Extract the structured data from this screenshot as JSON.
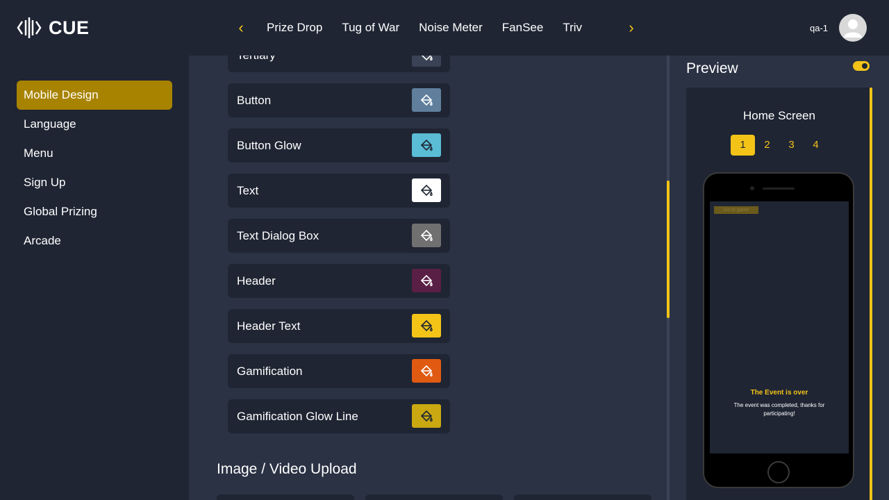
{
  "brand": {
    "logo_text": "CUE"
  },
  "header": {
    "tabs": [
      "Prize Drop",
      "Tug of War",
      "Noise Meter",
      "FanSee",
      "Triv"
    ],
    "user_name": "qa-1"
  },
  "sidebar": {
    "items": [
      {
        "label": "Mobile Design",
        "active": true
      },
      {
        "label": "Language"
      },
      {
        "label": "Menu"
      },
      {
        "label": "Sign Up"
      },
      {
        "label": "Global Prizing"
      },
      {
        "label": "Arcade"
      }
    ]
  },
  "colors": {
    "accent": "#f3c318",
    "rows": [
      {
        "label": "Tertiary",
        "color": "#3a4356"
      },
      {
        "label": "Button",
        "color": "#5f7f9c"
      },
      {
        "label": "Button Glow",
        "color": "#5bbcd6"
      },
      {
        "label": "Text",
        "color": "#ffffff"
      },
      {
        "label": "Text Dialog Box",
        "color": "#707070"
      },
      {
        "label": "Header",
        "color": "#5a1f45"
      },
      {
        "label": "Header Text",
        "color": "#f3c318"
      },
      {
        "label": "Gamification",
        "color": "#e05a12"
      },
      {
        "label": "Gamification Glow Line",
        "color": "#c9a812"
      }
    ]
  },
  "upload": {
    "title": "Image / Video Upload"
  },
  "preview": {
    "title": "Preview",
    "screen_title": "Home Screen",
    "pages": [
      "1",
      "2",
      "3",
      "4"
    ],
    "active_page": "1",
    "phone": {
      "go_button": "Go to game",
      "event_title": "The Event is over",
      "event_message": "The event was completed, thanks for participating!"
    }
  }
}
